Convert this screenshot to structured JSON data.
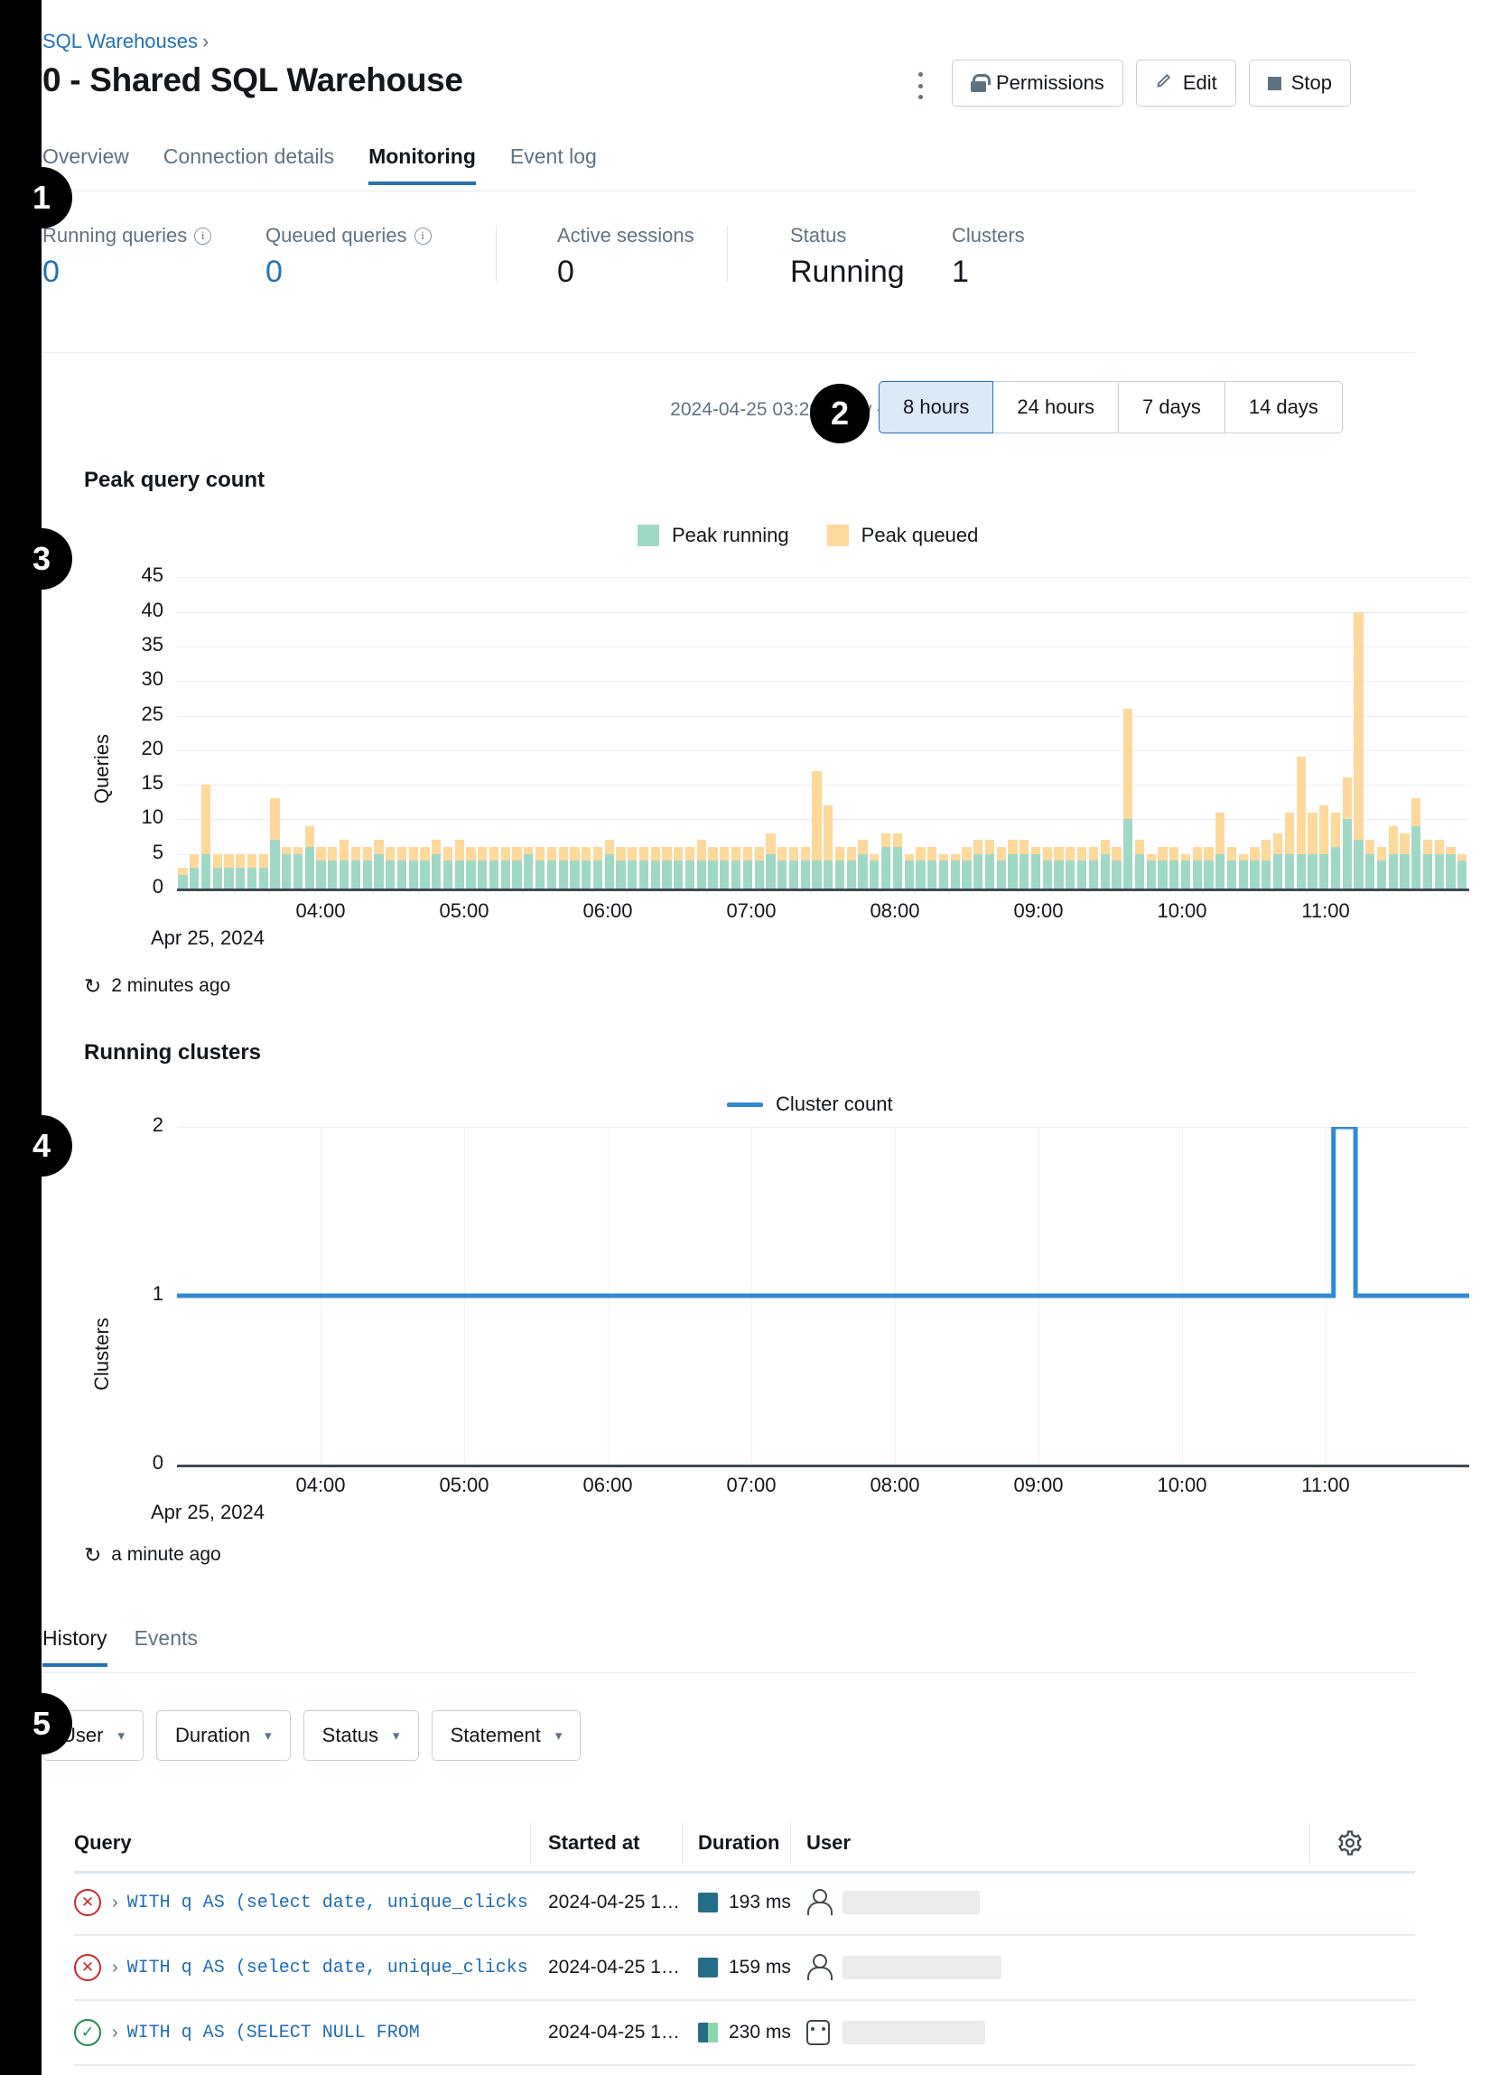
{
  "header": {
    "breadcrumb": "SQL Warehouses",
    "breadcrumb_sep": "›",
    "title": "0 - Shared SQL Warehouse",
    "kebab_icon": "more-vertical-icon",
    "buttons": [
      {
        "label": "Permissions",
        "icon": "lock-icon"
      },
      {
        "label": "Edit",
        "icon": "pencil-icon"
      },
      {
        "label": "Stop",
        "icon": "stop-square-icon"
      }
    ]
  },
  "tabs": [
    {
      "label": "Overview",
      "active": false
    },
    {
      "label": "Connection details",
      "active": false
    },
    {
      "label": "Monitoring",
      "active": true
    },
    {
      "label": "Event log",
      "active": false
    }
  ],
  "stats": [
    {
      "label": "Running queries",
      "value": "0",
      "info": true,
      "link": true
    },
    {
      "label": "Queued queries",
      "value": "0",
      "info": true,
      "link": true
    },
    {
      "label": "Active sessions",
      "value": "0",
      "info": false,
      "link": false
    },
    {
      "label": "Status",
      "value": "Running",
      "info": false,
      "link": false
    },
    {
      "label": "Clusters",
      "value": "1",
      "info": false,
      "link": false
    }
  ],
  "time_range": {
    "text": "2024-04-25 03:20 - now -",
    "options": [
      {
        "label": "8 hours",
        "active": true
      },
      {
        "label": "24 hours",
        "active": false
      },
      {
        "label": "7 days",
        "active": false
      },
      {
        "label": "14 days",
        "active": false
      }
    ]
  },
  "peak_chart": {
    "title": "Peak query count",
    "refresh_text": "2 minutes ago",
    "refresh_icon": "refresh-icon"
  },
  "clusters_chart": {
    "title": "Running clusters",
    "refresh_text": "a minute ago",
    "refresh_icon": "refresh-icon"
  },
  "bottom_tabs": [
    {
      "label": "History",
      "active": true
    },
    {
      "label": "Events",
      "active": false
    }
  ],
  "filters": [
    {
      "label": "User"
    },
    {
      "label": "Duration"
    },
    {
      "label": "Status"
    },
    {
      "label": "Statement"
    }
  ],
  "table": {
    "columns": [
      "Query",
      "Started at",
      "Duration",
      "User"
    ],
    "settings_icon": "gear-icon",
    "rows": [
      {
        "status": "failed",
        "status_icon": "error-circle-icon",
        "query": "WITH q AS (select date, unique_clicks, total_…",
        "query_blank": "",
        "started_at": "2024-04-25 1…",
        "duration": "193 ms",
        "duration_split": false,
        "user_icon": "person-icon",
        "user": ""
      },
      {
        "status": "failed",
        "status_icon": "error-circle-icon",
        "query": "WITH q AS (select date, unique_clicks, total_…",
        "query_blank": "",
        "started_at": "2024-04-25 1…",
        "duration": "159 ms",
        "duration_split": false,
        "user_icon": "person-icon",
        "user": ""
      },
      {
        "status": "success",
        "status_icon": "check-circle-icon",
        "query": "WITH q AS (SELECT NULL FROM ",
        "query_blank": "____________…",
        "started_at": "2024-04-25 1…",
        "duration": "230 ms",
        "duration_split": true,
        "user_icon": "robot-icon",
        "user": ""
      }
    ]
  },
  "callouts": [
    {
      "n": "1"
    },
    {
      "n": "2"
    },
    {
      "n": "3"
    },
    {
      "n": "4"
    },
    {
      "n": "5"
    }
  ],
  "colors": {
    "accent": "#2272b4",
    "peak_running": "#9fd9c5",
    "peak_queued": "#ffd89b",
    "cluster_line": "#2f8ad6",
    "error": "#c82d2d",
    "success": "#1f8a4c"
  },
  "chart_data": [
    {
      "type": "bar",
      "title": "Peak query count",
      "stacked": true,
      "xlabel": "",
      "ylabel": "Queries",
      "ylim": [
        0,
        47
      ],
      "yticks": [
        0,
        5,
        10,
        15,
        20,
        25,
        30,
        35,
        40,
        45
      ],
      "xticks": [
        "04:00",
        "05:00",
        "06:00",
        "07:00",
        "08:00",
        "09:00",
        "10:00",
        "11:00"
      ],
      "x_subtitle": "Apr 25, 2024",
      "grid": true,
      "legend": [
        "Peak running",
        "Peak queued"
      ],
      "legend_position": "top-center",
      "series": [
        {
          "name": "Peak running",
          "color": "#9fd9c5",
          "values": [
            2,
            3,
            5,
            3,
            3,
            3,
            3,
            3,
            7,
            5,
            5,
            6,
            4,
            4,
            4,
            4,
            4,
            5,
            4,
            4,
            4,
            4,
            5,
            4,
            4,
            4,
            4,
            4,
            4,
            4,
            5,
            4,
            4,
            4,
            4,
            4,
            4,
            5,
            4,
            4,
            4,
            4,
            4,
            4,
            4,
            4,
            4,
            4,
            4,
            4,
            4,
            5,
            4,
            4,
            4,
            4,
            4,
            4,
            4,
            5,
            4,
            6,
            6,
            4,
            4,
            4,
            4,
            4,
            4,
            5,
            5,
            4,
            5,
            5,
            5,
            4,
            4,
            4,
            4,
            4,
            5,
            4,
            10,
            5,
            4,
            4,
            4,
            4,
            4,
            4,
            5,
            4,
            4,
            4,
            4,
            5,
            5,
            5,
            5,
            5,
            6,
            10,
            7,
            5,
            4,
            5,
            5,
            9,
            5,
            5,
            5,
            4
          ]
        },
        {
          "name": "Peak queued",
          "color": "#ffd89b",
          "values": [
            1,
            2,
            10,
            2,
            2,
            2,
            2,
            2,
            6,
            1,
            1,
            3,
            2,
            2,
            3,
            2,
            2,
            2,
            2,
            2,
            2,
            2,
            2,
            2,
            3,
            2,
            2,
            2,
            2,
            2,
            1,
            2,
            2,
            2,
            2,
            2,
            2,
            2,
            2,
            2,
            2,
            2,
            2,
            2,
            2,
            3,
            2,
            2,
            2,
            2,
            2,
            3,
            2,
            2,
            2,
            13,
            8,
            2,
            2,
            2,
            1,
            2,
            2,
            1,
            2,
            2,
            1,
            1,
            2,
            2,
            2,
            2,
            2,
            2,
            1,
            2,
            2,
            2,
            2,
            2,
            2,
            2,
            16,
            2,
            1,
            2,
            2,
            1,
            2,
            2,
            6,
            2,
            1,
            2,
            3,
            3,
            6,
            14,
            6,
            7,
            5,
            6,
            33,
            2,
            2,
            4,
            3,
            4,
            2,
            2,
            1,
            1
          ]
        }
      ]
    },
    {
      "type": "line",
      "title": "Running clusters",
      "xlabel": "",
      "ylabel": "Clusters",
      "ylim": [
        0,
        2
      ],
      "yticks": [
        0,
        1,
        2
      ],
      "xticks": [
        "04:00",
        "05:00",
        "06:00",
        "07:00",
        "08:00",
        "09:00",
        "10:00",
        "11:00"
      ],
      "x_subtitle": "Apr 25, 2024",
      "grid": true,
      "legend": [
        "Cluster count"
      ],
      "legend_position": "top-center",
      "series": [
        {
          "name": "Cluster count",
          "color": "#2f8ad6",
          "points": [
            {
              "x": 0.0,
              "y": 1
            },
            {
              "x": 0.895,
              "y": 1
            },
            {
              "x": 0.895,
              "y": 2
            },
            {
              "x": 0.912,
              "y": 2
            },
            {
              "x": 0.912,
              "y": 1
            },
            {
              "x": 1.0,
              "y": 1
            }
          ]
        }
      ]
    }
  ]
}
